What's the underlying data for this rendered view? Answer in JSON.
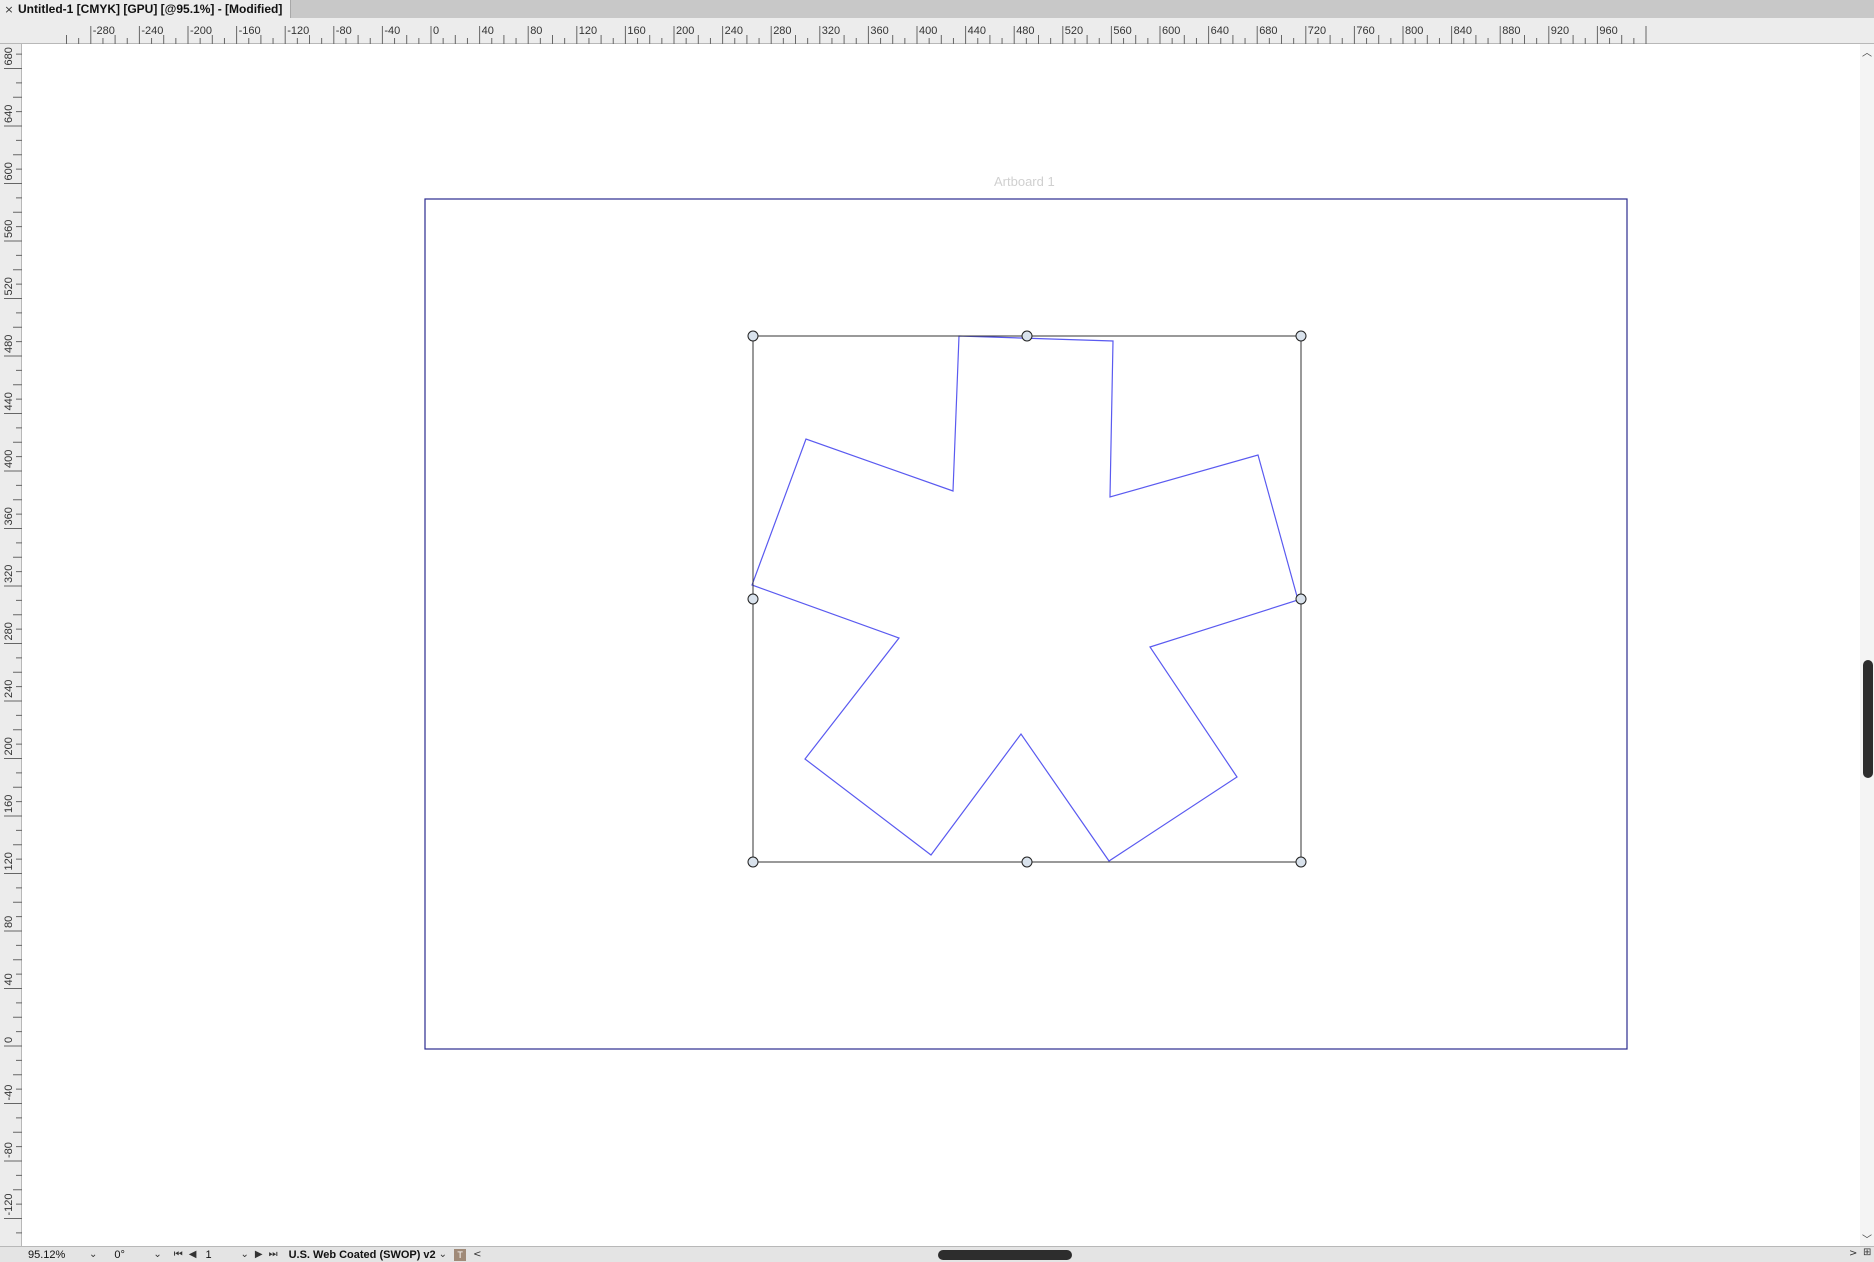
{
  "document_tab": {
    "close_glyph": "×",
    "title": "Untitled-1 [CMYK] [GPU] [@95.1%] - [Modified]"
  },
  "rulers": {
    "origin_glyph": "⋮",
    "horizontal_labels": [
      "-280",
      "-240",
      "-200",
      "-160",
      "-120",
      "-80",
      "-40",
      "0",
      "40",
      "80",
      "120",
      "160",
      "200",
      "240",
      "280",
      "320",
      "360",
      "400",
      "440",
      "480",
      "520",
      "560",
      "600",
      "640",
      "680",
      "720",
      "760",
      "800",
      "840",
      "880",
      "920",
      "960"
    ],
    "vertical_labels": [
      "680",
      "640",
      "600",
      "560",
      "520",
      "480",
      "440",
      "400",
      "360",
      "320",
      "280",
      "240",
      "200",
      "160",
      "120",
      "80",
      "40",
      "0",
      "-40",
      "-80",
      "-120"
    ]
  },
  "canvas": {
    "artboard_label": "Artboard 1",
    "artboard_stroke": "#2b2b8f",
    "shape_stroke": "#5a5af0",
    "selection_stroke": "#333333",
    "handle_fill": "#d9e2ec"
  },
  "statusbar": {
    "zoom": "95.12%",
    "rotation": "0°",
    "page": "1",
    "color_profile": "U.S. Web Coated (SWOP) v2",
    "dropdown_glyph": "⌄",
    "first_glyph": "⏮",
    "prev_glyph": "◀",
    "next_glyph": "▶",
    "last_glyph": "⏭",
    "left_arrow": "<",
    "right_arrow": ">",
    "corner_glyph": "⊞",
    "badge_glyph": "T"
  }
}
